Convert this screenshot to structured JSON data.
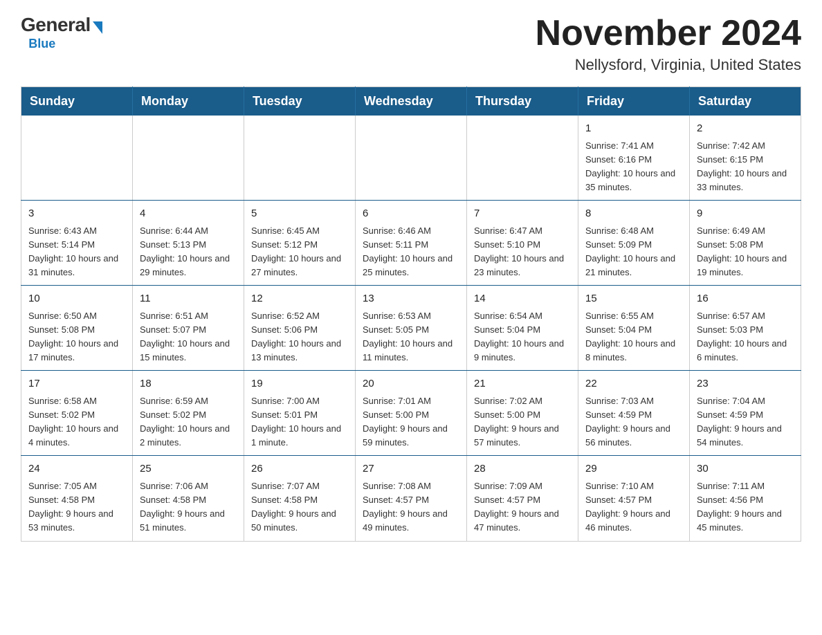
{
  "logo": {
    "general": "General",
    "blue": "Blue"
  },
  "header": {
    "month_title": "November 2024",
    "location": "Nellysford, Virginia, United States"
  },
  "days_of_week": [
    "Sunday",
    "Monday",
    "Tuesday",
    "Wednesday",
    "Thursday",
    "Friday",
    "Saturday"
  ],
  "weeks": [
    [
      {
        "day": "",
        "info": ""
      },
      {
        "day": "",
        "info": ""
      },
      {
        "day": "",
        "info": ""
      },
      {
        "day": "",
        "info": ""
      },
      {
        "day": "",
        "info": ""
      },
      {
        "day": "1",
        "info": "Sunrise: 7:41 AM\nSunset: 6:16 PM\nDaylight: 10 hours and 35 minutes."
      },
      {
        "day": "2",
        "info": "Sunrise: 7:42 AM\nSunset: 6:15 PM\nDaylight: 10 hours and 33 minutes."
      }
    ],
    [
      {
        "day": "3",
        "info": "Sunrise: 6:43 AM\nSunset: 5:14 PM\nDaylight: 10 hours and 31 minutes."
      },
      {
        "day": "4",
        "info": "Sunrise: 6:44 AM\nSunset: 5:13 PM\nDaylight: 10 hours and 29 minutes."
      },
      {
        "day": "5",
        "info": "Sunrise: 6:45 AM\nSunset: 5:12 PM\nDaylight: 10 hours and 27 minutes."
      },
      {
        "day": "6",
        "info": "Sunrise: 6:46 AM\nSunset: 5:11 PM\nDaylight: 10 hours and 25 minutes."
      },
      {
        "day": "7",
        "info": "Sunrise: 6:47 AM\nSunset: 5:10 PM\nDaylight: 10 hours and 23 minutes."
      },
      {
        "day": "8",
        "info": "Sunrise: 6:48 AM\nSunset: 5:09 PM\nDaylight: 10 hours and 21 minutes."
      },
      {
        "day": "9",
        "info": "Sunrise: 6:49 AM\nSunset: 5:08 PM\nDaylight: 10 hours and 19 minutes."
      }
    ],
    [
      {
        "day": "10",
        "info": "Sunrise: 6:50 AM\nSunset: 5:08 PM\nDaylight: 10 hours and 17 minutes."
      },
      {
        "day": "11",
        "info": "Sunrise: 6:51 AM\nSunset: 5:07 PM\nDaylight: 10 hours and 15 minutes."
      },
      {
        "day": "12",
        "info": "Sunrise: 6:52 AM\nSunset: 5:06 PM\nDaylight: 10 hours and 13 minutes."
      },
      {
        "day": "13",
        "info": "Sunrise: 6:53 AM\nSunset: 5:05 PM\nDaylight: 10 hours and 11 minutes."
      },
      {
        "day": "14",
        "info": "Sunrise: 6:54 AM\nSunset: 5:04 PM\nDaylight: 10 hours and 9 minutes."
      },
      {
        "day": "15",
        "info": "Sunrise: 6:55 AM\nSunset: 5:04 PM\nDaylight: 10 hours and 8 minutes."
      },
      {
        "day": "16",
        "info": "Sunrise: 6:57 AM\nSunset: 5:03 PM\nDaylight: 10 hours and 6 minutes."
      }
    ],
    [
      {
        "day": "17",
        "info": "Sunrise: 6:58 AM\nSunset: 5:02 PM\nDaylight: 10 hours and 4 minutes."
      },
      {
        "day": "18",
        "info": "Sunrise: 6:59 AM\nSunset: 5:02 PM\nDaylight: 10 hours and 2 minutes."
      },
      {
        "day": "19",
        "info": "Sunrise: 7:00 AM\nSunset: 5:01 PM\nDaylight: 10 hours and 1 minute."
      },
      {
        "day": "20",
        "info": "Sunrise: 7:01 AM\nSunset: 5:00 PM\nDaylight: 9 hours and 59 minutes."
      },
      {
        "day": "21",
        "info": "Sunrise: 7:02 AM\nSunset: 5:00 PM\nDaylight: 9 hours and 57 minutes."
      },
      {
        "day": "22",
        "info": "Sunrise: 7:03 AM\nSunset: 4:59 PM\nDaylight: 9 hours and 56 minutes."
      },
      {
        "day": "23",
        "info": "Sunrise: 7:04 AM\nSunset: 4:59 PM\nDaylight: 9 hours and 54 minutes."
      }
    ],
    [
      {
        "day": "24",
        "info": "Sunrise: 7:05 AM\nSunset: 4:58 PM\nDaylight: 9 hours and 53 minutes."
      },
      {
        "day": "25",
        "info": "Sunrise: 7:06 AM\nSunset: 4:58 PM\nDaylight: 9 hours and 51 minutes."
      },
      {
        "day": "26",
        "info": "Sunrise: 7:07 AM\nSunset: 4:58 PM\nDaylight: 9 hours and 50 minutes."
      },
      {
        "day": "27",
        "info": "Sunrise: 7:08 AM\nSunset: 4:57 PM\nDaylight: 9 hours and 49 minutes."
      },
      {
        "day": "28",
        "info": "Sunrise: 7:09 AM\nSunset: 4:57 PM\nDaylight: 9 hours and 47 minutes."
      },
      {
        "day": "29",
        "info": "Sunrise: 7:10 AM\nSunset: 4:57 PM\nDaylight: 9 hours and 46 minutes."
      },
      {
        "day": "30",
        "info": "Sunrise: 7:11 AM\nSunset: 4:56 PM\nDaylight: 9 hours and 45 minutes."
      }
    ]
  ]
}
